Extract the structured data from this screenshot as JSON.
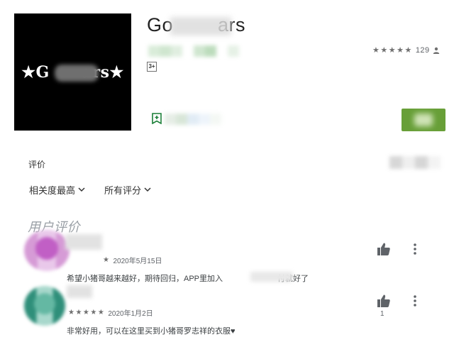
{
  "app": {
    "title": "Go   ars",
    "icon_text": "★G  ars★",
    "age_rating": "3+",
    "developer_blocks": [
      "#d9ecd9",
      "#cfe6cf",
      "#e0eee0",
      "#ffffff",
      "#cfe6cf",
      "#bcdcbc",
      "#ffffff",
      "#e6f1e6"
    ],
    "wishlist_blocks": [
      "#e6ede6",
      "#d8e6d8",
      "#e1ecf5",
      "#eef4fb",
      "#f4f8f4"
    ],
    "rating_count": "129",
    "rating_stars": "★★★★★",
    "install_color": "#689f38"
  },
  "reviews_header": {
    "label": "评价",
    "right_blocks": [
      "#d7d7d7",
      "#efefef",
      "#d6d6d6",
      "#f3f3f3"
    ],
    "sort_label": "相关度最高",
    "filter_label": "所有评分",
    "user_reviews_title": "用户评价"
  },
  "reviews": [
    {
      "stars": "★",
      "date": "2020年5月15日",
      "text": "希望小猪哥越来越好，期待回归，APP里加入       付就好了",
      "avatar_colors": [
        "#c15fc5",
        "#e9c8ea",
        "#d69bd6"
      ],
      "helpful_count": ""
    },
    {
      "stars": "★★★★★",
      "date": "2020年1月2日",
      "text": "非常好用，可以在这里买到小猪哥罗志祥的衣服♥",
      "avatar_colors": [
        "#64b8a3",
        "#a8d8cc",
        "#2f8f7a"
      ],
      "helpful_count": "1"
    }
  ]
}
